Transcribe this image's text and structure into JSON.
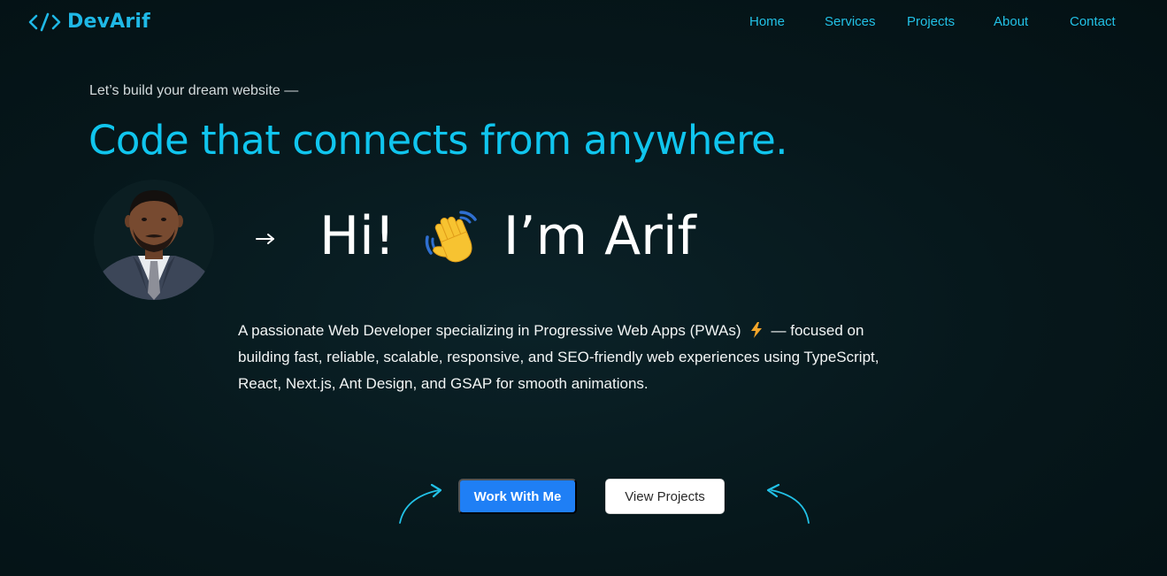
{
  "brand": {
    "name": "DevArif",
    "icon": "code-icon",
    "color": "#1fb8e6"
  },
  "nav": {
    "items": [
      {
        "label": "Home"
      },
      {
        "label": "Services"
      },
      {
        "label": "Projects"
      },
      {
        "label": "About"
      },
      {
        "label": "Contact"
      }
    ],
    "color": "#22c1e6"
  },
  "hero": {
    "tagline": "Let’s build your dream website —",
    "headline": "Code that connects from anywhere.",
    "headline_color": "#10c5ee",
    "greeting_hi": "Hi!",
    "greeting_name": "I’m Arif",
    "description_part1": "A passionate Web Developer specializing in Progressive Web Apps (PWAs)",
    "description_part2": "— focused on building fast, reliable, scalable, responsive, and SEO-friendly web experiences using TypeScript, React, Next.js, Ant Design, and GSAP for smooth animations."
  },
  "actions": {
    "primary_label": "Work With Me",
    "secondary_label": "View Projects",
    "primary_color": "#1f7ff5"
  },
  "icons": {
    "arrow": "arrow-right-icon",
    "wave": "waving-hand-icon",
    "bolt": "lightning-bolt-icon",
    "curved_arrows": "curved-arrow-icon"
  }
}
